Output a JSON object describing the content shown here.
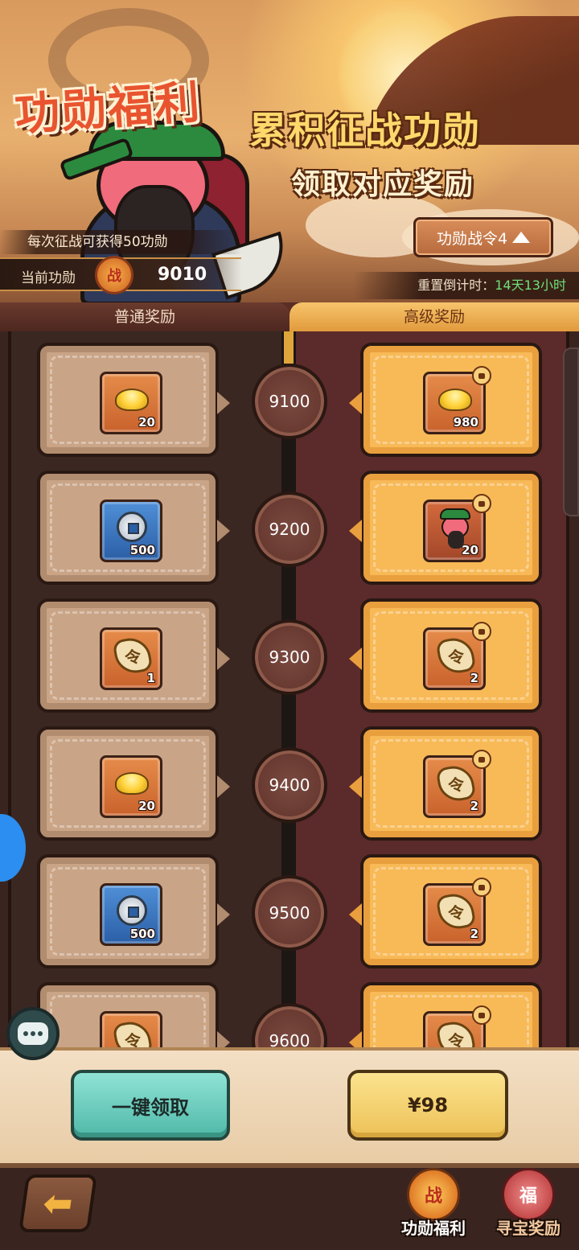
{
  "banner": {
    "event_title": "功勋福利",
    "headline": "累积征战功勋",
    "subheadline": "领取对应奖励",
    "gain_tip": "每次征战可获得50功勋",
    "merit_label": "当前功勋",
    "merit_coin_glyph": "战",
    "merit_value": "9010",
    "pass_button_label": "功勋战令4",
    "reset_label": "重置倒计时：",
    "reset_time": "14天13小时"
  },
  "tabs": {
    "normal": "普通奖励",
    "premium": "高级奖励",
    "active": "premium"
  },
  "progress_fraction": 0.0,
  "tiers": [
    {
      "threshold": "9100",
      "normal": {
        "icon": "gold-ingot-icon",
        "qty": "20"
      },
      "premium": {
        "icon": "gold-ingot-icon",
        "qty": "980"
      }
    },
    {
      "threshold": "9200",
      "normal": {
        "icon": "copper-coin-icon",
        "qty": "500"
      },
      "premium": {
        "icon": "hero-shard-icon",
        "qty": "20"
      }
    },
    {
      "threshold": "9300",
      "normal": {
        "icon": "command-token-icon",
        "qty": "1"
      },
      "premium": {
        "icon": "command-token-icon",
        "qty": "2"
      }
    },
    {
      "threshold": "9400",
      "normal": {
        "icon": "gold-ingot-icon",
        "qty": "20"
      },
      "premium": {
        "icon": "command-token-icon",
        "qty": "2"
      }
    },
    {
      "threshold": "9500",
      "normal": {
        "icon": "copper-coin-icon",
        "qty": "500"
      },
      "premium": {
        "icon": "command-token-icon",
        "qty": "2"
      }
    },
    {
      "threshold": "9600",
      "normal": {
        "icon": "command-token-icon",
        "qty": ""
      },
      "premium": {
        "icon": "command-token-icon",
        "qty": ""
      }
    }
  ],
  "token_glyph": "令",
  "actions": {
    "claim_all": "一键领取",
    "buy_price": "¥98"
  },
  "nav": {
    "back_icon": "back-arrow-icon",
    "merit": {
      "label": "功勋福利",
      "glyph": "战"
    },
    "treasure": {
      "label": "寻宝奖励",
      "glyph": "福"
    }
  },
  "colors": {
    "premium_card": "#f8b957",
    "normal_card": "#c9a486",
    "claim_button": "#4fb8a8",
    "buy_button": "#edc157",
    "reset_time": "#6fe07a"
  }
}
